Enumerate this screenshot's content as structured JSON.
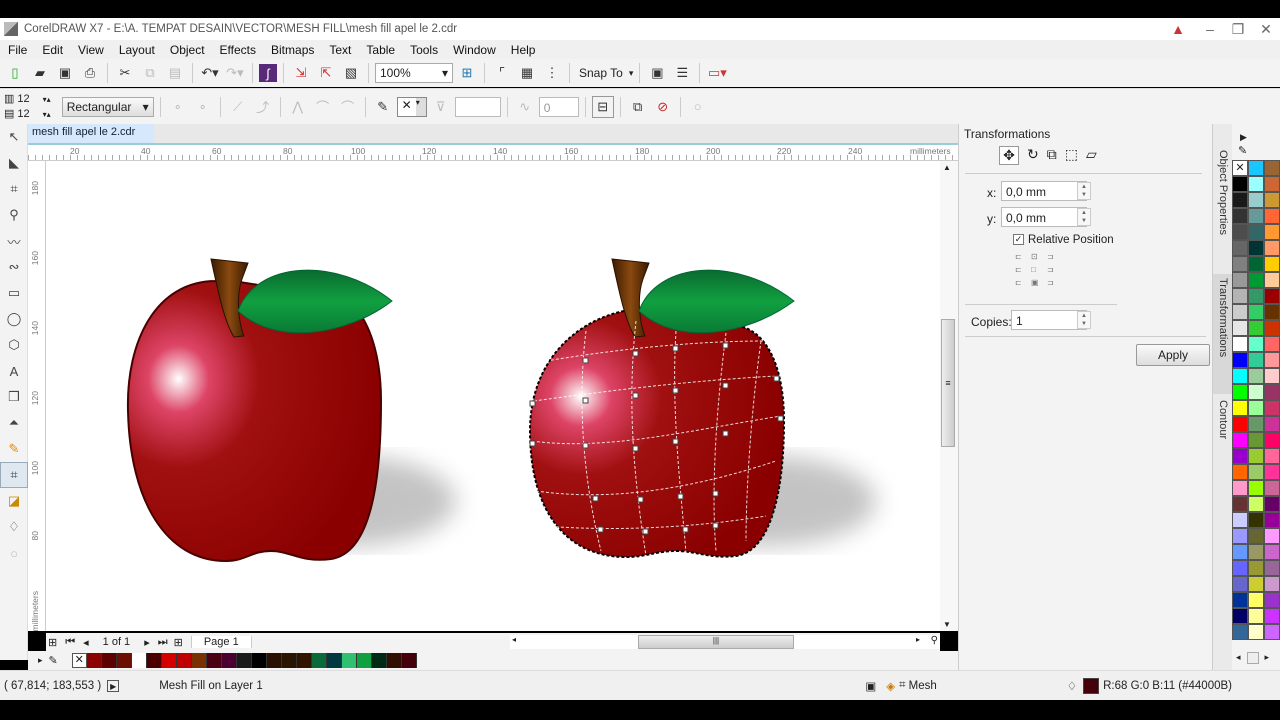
{
  "window": {
    "title": "CorelDRAW X7 - E:\\A. TEMPAT DESAIN\\VECTOR\\MESH FILL\\mesh fill apel le 2.cdr"
  },
  "menu": [
    "File",
    "Edit",
    "View",
    "Layout",
    "Object",
    "Effects",
    "Bitmaps",
    "Text",
    "Table",
    "Tools",
    "Window",
    "Help"
  ],
  "toolbar": {
    "zoom": "100%",
    "snap_to": "Snap To"
  },
  "propbar": {
    "grid_cols": "12",
    "grid_rows": "12",
    "selection_mode": "Rectangular",
    "transparency_value": "0"
  },
  "document": {
    "tab_label": "mesh fill apel le 2.cdr",
    "ruler_unit": "millimeters",
    "h_ruler_ticks": [
      "20",
      "40",
      "60",
      "80",
      "100",
      "120",
      "140",
      "160",
      "180",
      "200",
      "220",
      "240"
    ],
    "v_ruler_ticks": [
      "180",
      "160",
      "140",
      "120",
      "100",
      "80"
    ]
  },
  "pagebar": {
    "page_count": "1 of 1",
    "page_tab": "Page 1"
  },
  "docpalette": [
    "#8b0000",
    "#5c0000",
    "#6b1000",
    "#ffffff",
    "#4a0000",
    "#d40000",
    "#c00000",
    "#7a3000",
    "#4a0010",
    "#4a0030",
    "#1a1a1a",
    "#000000",
    "#2a1000",
    "#2a1500",
    "#301400",
    "#0a6a3a",
    "#003a40",
    "#30c070",
    "#10a040",
    "#002a18",
    "#301000",
    "#44000b"
  ],
  "status": {
    "coords": "( 67,814; 183,553 )",
    "object_info": "Mesh Fill on Layer 1",
    "fill_label": "Mesh",
    "outline_color_text": "R:68 G:0 B:11 (#44000B)",
    "outline_color": "#44000B"
  },
  "docker": {
    "title": "Transformations",
    "x_label": "x:",
    "x_value": "0,0 mm",
    "y_label": "y:",
    "y_value": "0,0 mm",
    "relative_position": "Relative Position",
    "relative_checked": true,
    "copies_label": "Copies:",
    "copies_value": "1",
    "apply": "Apply"
  },
  "docker_tabs": [
    "Object Properties",
    "Transformations",
    "Contour"
  ],
  "palette": {
    "col1": [
      "#000000",
      "#1a1a1a",
      "#333333",
      "#4d4d4d",
      "#666666",
      "#808080",
      "#999999",
      "#b3b3b3",
      "#cccccc",
      "#e6e6e6",
      "#ffffff",
      "#0000ff",
      "#00ffff",
      "#00ff00",
      "#ffff00",
      "#ff0000",
      "#ff00ff",
      "#9900cc",
      "#ff6600",
      "#ff99cc",
      "#663333",
      "#ccccff",
      "#9999ff",
      "#6699ff",
      "#6666ff",
      "#6666cc",
      "#003399",
      "#000066",
      "#336699"
    ],
    "col2": [
      "#1ac6ff",
      "#99ffff",
      "#99cccc",
      "#669999",
      "#336666",
      "#003333",
      "#006633",
      "#009933",
      "#339966",
      "#33cc66",
      "#33cc33",
      "#66ffcc",
      "#33cc99",
      "#99cc99",
      "#ccffcc",
      "#99ff99",
      "#669966",
      "#669933",
      "#99cc33",
      "#99cc66",
      "#99ff00",
      "#ccff66",
      "#333300",
      "#666633",
      "#999966",
      "#999933",
      "#cccc33",
      "#ffff66",
      "#ffff99",
      "#ffffcc"
    ],
    "col3": [
      "#996633",
      "#cc6633",
      "#cc9933",
      "#ff6633",
      "#ff9933",
      "#ff9966",
      "#ffcc00",
      "#ffcc99",
      "#990000",
      "#663300",
      "#cc3300",
      "#ff6666",
      "#ff9999",
      "#ffcccc",
      "#993366",
      "#cc3366",
      "#cc3399",
      "#ff0066",
      "#ff6699",
      "#ff3399",
      "#cc6699",
      "#660066",
      "#990099",
      "#ff99ff",
      "#cc66cc",
      "#996699",
      "#cc99cc",
      "#9933cc",
      "#cc33ff",
      "#cc66ff"
    ]
  }
}
